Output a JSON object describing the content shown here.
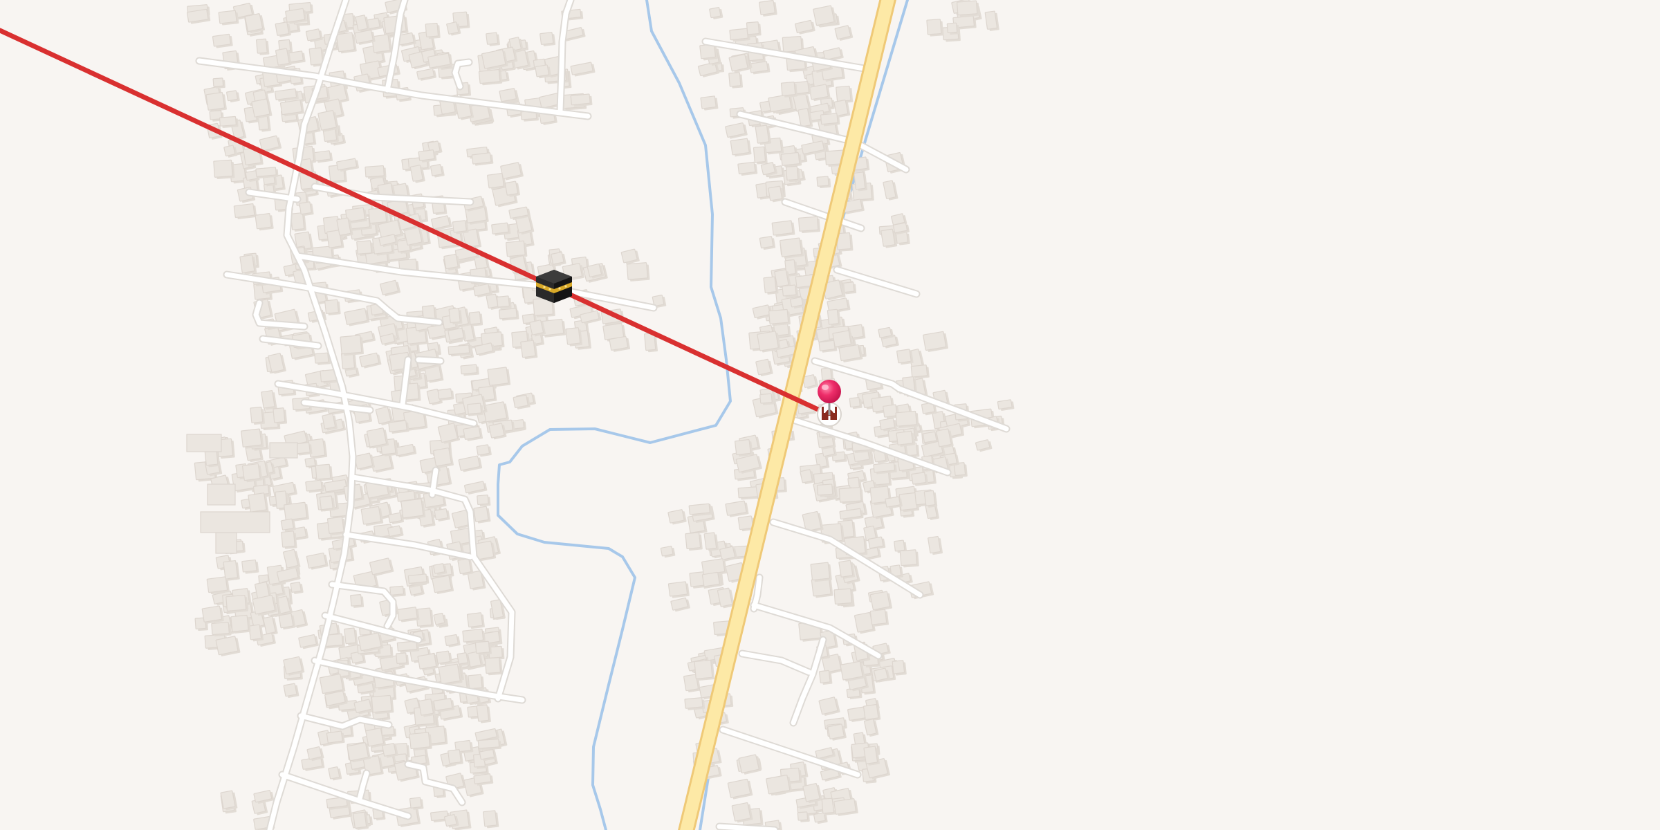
{
  "map": {
    "background_color": "#f8f5f2",
    "road_color": "#ffffff",
    "main_road_color": "#fde9a6",
    "main_road_edge_color": "#efc977",
    "water_color": "#a7c8ea",
    "building_color": "#ebe6e0",
    "qibla_line_color": "#d93030"
  },
  "markers": {
    "kaaba": {
      "icon": "kaaba-icon"
    },
    "location_pin": {
      "icon": "map-pin-icon",
      "color": "#e8185a"
    },
    "mosque": {
      "icon": "mosque-icon",
      "color": "#8a2b1f"
    }
  }
}
